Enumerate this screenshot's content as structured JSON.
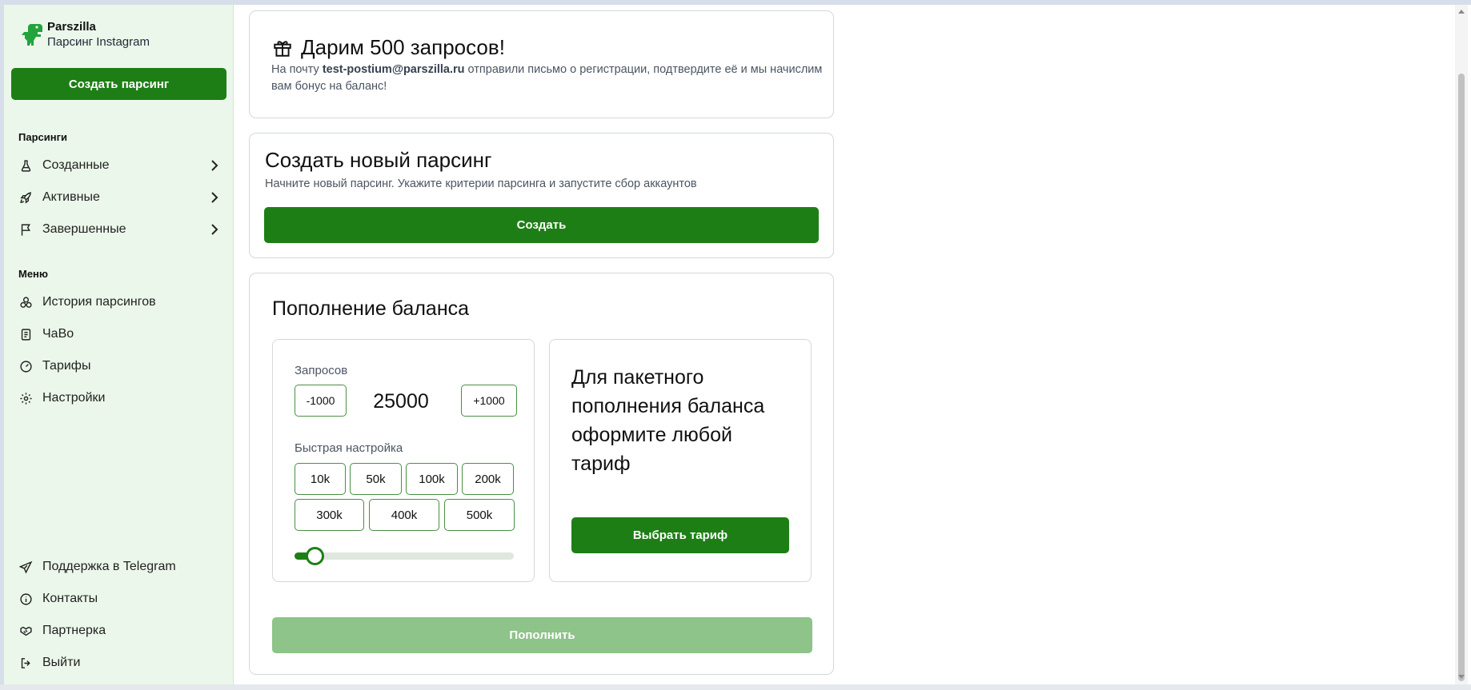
{
  "brand": {
    "name": "Parszilla",
    "subtitle": "Парсинг Instagram"
  },
  "sidebar": {
    "create_label": "Создать парсинг",
    "sections": {
      "parsings_title": "Парсинги",
      "menu_title": "Меню"
    },
    "parsings_items": [
      {
        "label": "Созданные",
        "icon": "flask-icon"
      },
      {
        "label": "Активные",
        "icon": "rocket-icon"
      },
      {
        "label": "Завершенные",
        "icon": "flag-icon"
      }
    ],
    "menu_items": [
      {
        "label": "История парсингов",
        "icon": "history-icon"
      },
      {
        "label": "ЧаВо",
        "icon": "faq-book-icon"
      },
      {
        "label": "Тарифы",
        "icon": "tariff-gauge-icon"
      },
      {
        "label": "Настройки",
        "icon": "gear-icon"
      }
    ],
    "bottom_items": [
      {
        "label": "Поддержка в Telegram",
        "icon": "telegram-icon"
      },
      {
        "label": "Контакты",
        "icon": "info-icon"
      },
      {
        "label": "Партнерка",
        "icon": "handshake-icon"
      },
      {
        "label": "Выйти",
        "icon": "logout-icon"
      }
    ]
  },
  "gift": {
    "title": "Дарим 500 запросов!",
    "text_before": "На почту ",
    "email": "test-postium@parszilla.ru",
    "text_after": " отправили письмо о регистрации, подтвердите её и мы начислим вам бонус на баланс!"
  },
  "new_parsing": {
    "title": "Создать новый парсинг",
    "description": "Начните новый парсинг. Укажите критерии парсинга и запустите сбор аккаунтов",
    "button_label": "Создать"
  },
  "balance": {
    "title": "Пополнение баланса",
    "requests_label": "Запросов",
    "minus_label": "-1000",
    "plus_label": "+1000",
    "value": "25000",
    "quick_label": "Быстрая настройка",
    "presets_row1": [
      "10k",
      "50k",
      "100k",
      "200k"
    ],
    "presets_row2": [
      "300k",
      "400k",
      "500k"
    ],
    "slider_fraction": 0.05,
    "tariff_text": "Для пакетного пополнения баланса оформите любой тариф",
    "tariff_button": "Выбрать тариф",
    "topup_button": "Пополнить"
  },
  "colors": {
    "accent": "#1e7e16",
    "accent_disabled": "#8ec389",
    "sidebar_bg": "#ebf7ea"
  }
}
